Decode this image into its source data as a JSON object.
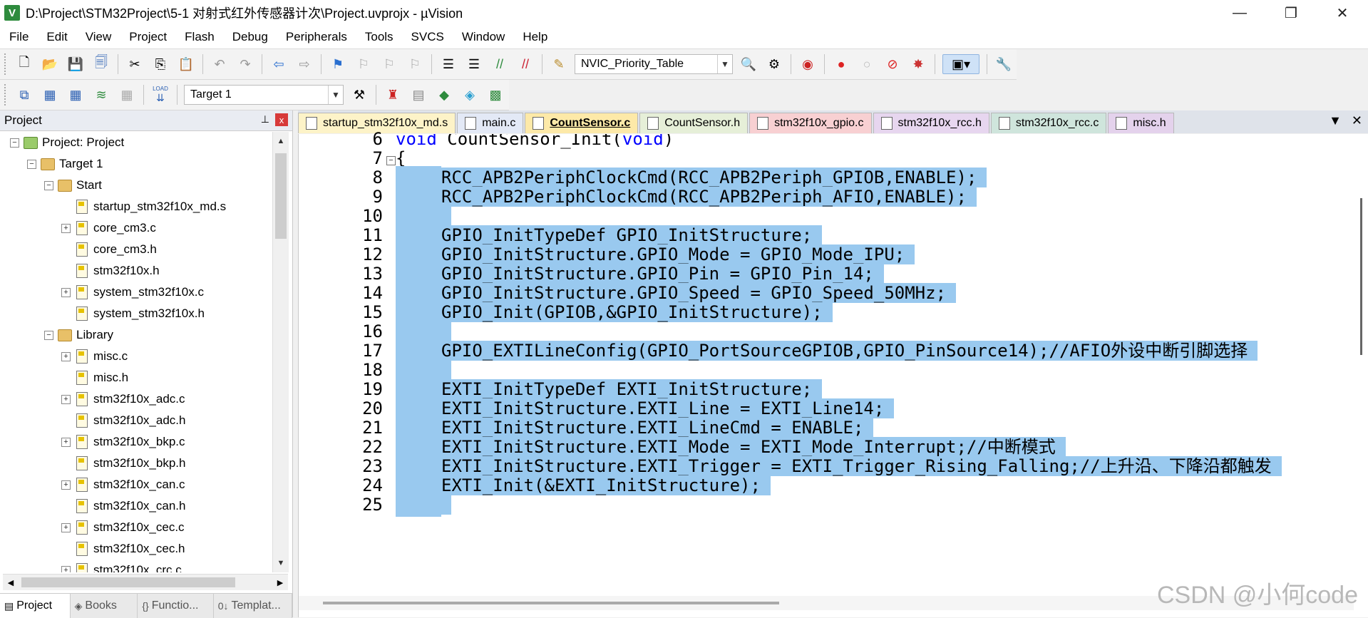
{
  "window": {
    "title": "D:\\Project\\STM32Project\\5-1 对射式红外传感器计次\\Project.uvprojx - µVision",
    "app_icon": "V",
    "minimize": "—",
    "maximize": "❐",
    "close": "✕"
  },
  "menu": [
    "File",
    "Edit",
    "View",
    "Project",
    "Flash",
    "Debug",
    "Peripherals",
    "Tools",
    "SVCS",
    "Window",
    "Help"
  ],
  "toolbar1": {
    "find_combo": "NVIC_Priority_Table"
  },
  "toolbar2": {
    "target_combo": "Target 1",
    "load_label": "LOAD"
  },
  "project_panel": {
    "title": "Project",
    "pin": "📌",
    "close": "x",
    "tree": [
      {
        "label": "Project: Project",
        "level": 0,
        "type": "root",
        "expander": "−"
      },
      {
        "label": "Target 1",
        "level": 1,
        "type": "target",
        "expander": "−"
      },
      {
        "label": "Start",
        "level": 2,
        "type": "folder",
        "expander": "−"
      },
      {
        "label": "startup_stm32f10x_md.s",
        "level": 3,
        "type": "file",
        "expander": ""
      },
      {
        "label": "core_cm3.c",
        "level": 3,
        "type": "file",
        "expander": "+"
      },
      {
        "label": "core_cm3.h",
        "level": 3,
        "type": "file",
        "expander": ""
      },
      {
        "label": "stm32f10x.h",
        "level": 3,
        "type": "file",
        "expander": ""
      },
      {
        "label": "system_stm32f10x.c",
        "level": 3,
        "type": "file",
        "expander": "+"
      },
      {
        "label": "system_stm32f10x.h",
        "level": 3,
        "type": "file",
        "expander": ""
      },
      {
        "label": "Library",
        "level": 2,
        "type": "folder",
        "expander": "−"
      },
      {
        "label": "misc.c",
        "level": 3,
        "type": "file",
        "expander": "+"
      },
      {
        "label": "misc.h",
        "level": 3,
        "type": "file",
        "expander": ""
      },
      {
        "label": "stm32f10x_adc.c",
        "level": 3,
        "type": "file",
        "expander": "+"
      },
      {
        "label": "stm32f10x_adc.h",
        "level": 3,
        "type": "file",
        "expander": ""
      },
      {
        "label": "stm32f10x_bkp.c",
        "level": 3,
        "type": "file",
        "expander": "+"
      },
      {
        "label": "stm32f10x_bkp.h",
        "level": 3,
        "type": "file",
        "expander": ""
      },
      {
        "label": "stm32f10x_can.c",
        "level": 3,
        "type": "file",
        "expander": "+"
      },
      {
        "label": "stm32f10x_can.h",
        "level": 3,
        "type": "file",
        "expander": ""
      },
      {
        "label": "stm32f10x_cec.c",
        "level": 3,
        "type": "file",
        "expander": "+"
      },
      {
        "label": "stm32f10x_cec.h",
        "level": 3,
        "type": "file",
        "expander": ""
      },
      {
        "label": "stm32f10x_crc.c",
        "level": 3,
        "type": "file",
        "expander": "+"
      }
    ],
    "bottom_tabs": [
      {
        "label": "Project",
        "icon": "▤"
      },
      {
        "label": "Books",
        "icon": "◈"
      },
      {
        "label": "Functio...",
        "icon": "{}"
      },
      {
        "label": "Templat...",
        "icon": "0↓"
      }
    ]
  },
  "editor_tabs": [
    {
      "label": "startup_stm32f10x_md.s",
      "color": "#fdf3c8",
      "active": false
    },
    {
      "label": "main.c",
      "color": "#e3e9f6",
      "active": false
    },
    {
      "label": "CountSensor.c",
      "color": "#fde9a8",
      "active": true
    },
    {
      "label": "CountSensor.h",
      "color": "#e6efd8",
      "active": false
    },
    {
      "label": "stm32f10x_gpio.c",
      "color": "#f8d0d2",
      "active": false
    },
    {
      "label": "stm32f10x_rcc.h",
      "color": "#e7d6ef",
      "active": false
    },
    {
      "label": "stm32f10x_rcc.c",
      "color": "#cfe5dc",
      "active": false
    },
    {
      "label": "misc.h",
      "color": "#e4d2ec",
      "active": false
    }
  ],
  "editor_tab_controls": {
    "list": "▼",
    "close": "✕"
  },
  "code": [
    {
      "num": "6",
      "text": "void CountSensor_Init(void)",
      "selected": false,
      "indent": false,
      "fold": ""
    },
    {
      "num": "7",
      "text": "{",
      "selected": false,
      "indent": false,
      "fold": "−"
    },
    {
      "num": "8",
      "text": "RCC_APB2PeriphClockCmd(RCC_APB2Periph_GPIOB,ENABLE);",
      "selected": true,
      "indent": true,
      "fold": ""
    },
    {
      "num": "9",
      "text": "RCC_APB2PeriphClockCmd(RCC_APB2Periph_AFIO,ENABLE);",
      "selected": true,
      "indent": true,
      "fold": ""
    },
    {
      "num": "10",
      "text": "",
      "selected": true,
      "indent": true,
      "fold": ""
    },
    {
      "num": "11",
      "text": "GPIO_InitTypeDef GPIO_InitStructure;",
      "selected": true,
      "indent": true,
      "fold": ""
    },
    {
      "num": "12",
      "text": "GPIO_InitStructure.GPIO_Mode = GPIO_Mode_IPU;",
      "selected": true,
      "indent": true,
      "fold": ""
    },
    {
      "num": "13",
      "text": "GPIO_InitStructure.GPIO_Pin = GPIO_Pin_14;",
      "selected": true,
      "indent": true,
      "fold": ""
    },
    {
      "num": "14",
      "text": "GPIO_InitStructure.GPIO_Speed = GPIO_Speed_50MHz;",
      "selected": true,
      "indent": true,
      "fold": ""
    },
    {
      "num": "15",
      "text": "GPIO_Init(GPIOB,&GPIO_InitStructure);",
      "selected": true,
      "indent": true,
      "fold": ""
    },
    {
      "num": "16",
      "text": "",
      "selected": true,
      "indent": true,
      "fold": ""
    },
    {
      "num": "17",
      "text": "GPIO_EXTILineConfig(GPIO_PortSourceGPIOB,GPIO_PinSource14);//AFIO外设中断引脚选择",
      "selected": true,
      "indent": true,
      "fold": ""
    },
    {
      "num": "18",
      "text": "",
      "selected": true,
      "indent": true,
      "fold": ""
    },
    {
      "num": "19",
      "text": "EXTI_InitTypeDef EXTI_InitStructure;",
      "selected": true,
      "indent": true,
      "fold": ""
    },
    {
      "num": "20",
      "text": "EXTI_InitStructure.EXTI_Line = EXTI_Line14;",
      "selected": true,
      "indent": true,
      "fold": ""
    },
    {
      "num": "21",
      "text": "EXTI_InitStructure.EXTI_LineCmd = ENABLE;",
      "selected": true,
      "indent": true,
      "fold": ""
    },
    {
      "num": "22",
      "text": "EXTI_InitStructure.EXTI_Mode = EXTI_Mode_Interrupt;//中断模式",
      "selected": true,
      "indent": true,
      "fold": ""
    },
    {
      "num": "23",
      "text": "EXTI_InitStructure.EXTI_Trigger = EXTI_Trigger_Rising_Falling;//上升沿、下降沿都触发",
      "selected": true,
      "indent": true,
      "fold": ""
    },
    {
      "num": "24",
      "text": "EXTI_Init(&EXTI_InitStructure);",
      "selected": true,
      "indent": true,
      "fold": ""
    },
    {
      "num": "25",
      "text": "",
      "selected": true,
      "indent": true,
      "fold": ""
    }
  ],
  "watermark": "CSDN @小何code",
  "colors": {
    "selection": "#99c9ef",
    "keyword": "#0000ff",
    "panel_header": "#e9ecf2"
  }
}
